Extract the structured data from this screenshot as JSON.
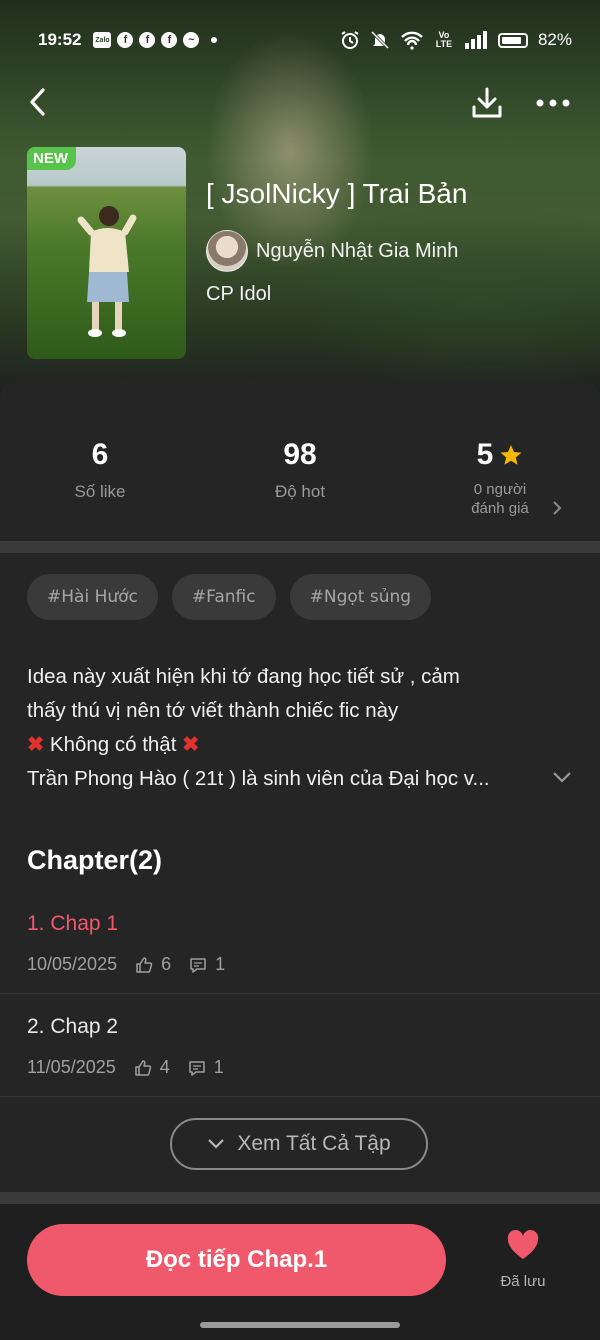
{
  "status_bar": {
    "time": "19:52",
    "app_icons": [
      "zalo-icon",
      "facebook-icon",
      "facebook-icon",
      "facebook-icon",
      "messenger-icon"
    ],
    "zalo_label": "Zalo",
    "network_label": "Vo LTE",
    "battery": "82%"
  },
  "story": {
    "badge": "NEW",
    "title": "[ JsolNicky ] Trai Bản",
    "author": "Nguyễn Nhật Gia Minh",
    "category": "CP Idol"
  },
  "stats": [
    {
      "value": "6",
      "label": "Số like"
    },
    {
      "value": "98",
      "label": "Độ hot"
    },
    {
      "value": "5",
      "label_line1": "0 người",
      "label_line2": "đánh giá"
    }
  ],
  "tags": [
    "#Hài Hước",
    "#Fanfic",
    "#Ngọt sủng"
  ],
  "description": {
    "line1": "Idea này xuất hiện khi tớ đang học tiết sử , cảm",
    "line2": "thấy thú vị nên tớ viết thành chiếc fic này",
    "line3": "Không có thật",
    "line4": "Trần Phong Hào ( 21t ) là sinh viên của Đại học v..."
  },
  "chapters": {
    "heading": "Chapter(2)",
    "items": [
      {
        "name": "1. Chap 1",
        "date": "10/05/2025",
        "likes": "6",
        "comments": "1",
        "color": "#f0586c"
      },
      {
        "name": "2. Chap 2",
        "date": "11/05/2025",
        "likes": "4",
        "comments": "1",
        "color": "#e8e8e8"
      }
    ],
    "view_all": "Xem Tất Cả Tập"
  },
  "actions": {
    "read": "Đọc tiếp Chap.1",
    "saved": "Đã lưu"
  },
  "colors": {
    "accent": "#f0586c",
    "badge_new": "#57c34a",
    "star": "#f5b800",
    "cross": "#e0322f"
  }
}
